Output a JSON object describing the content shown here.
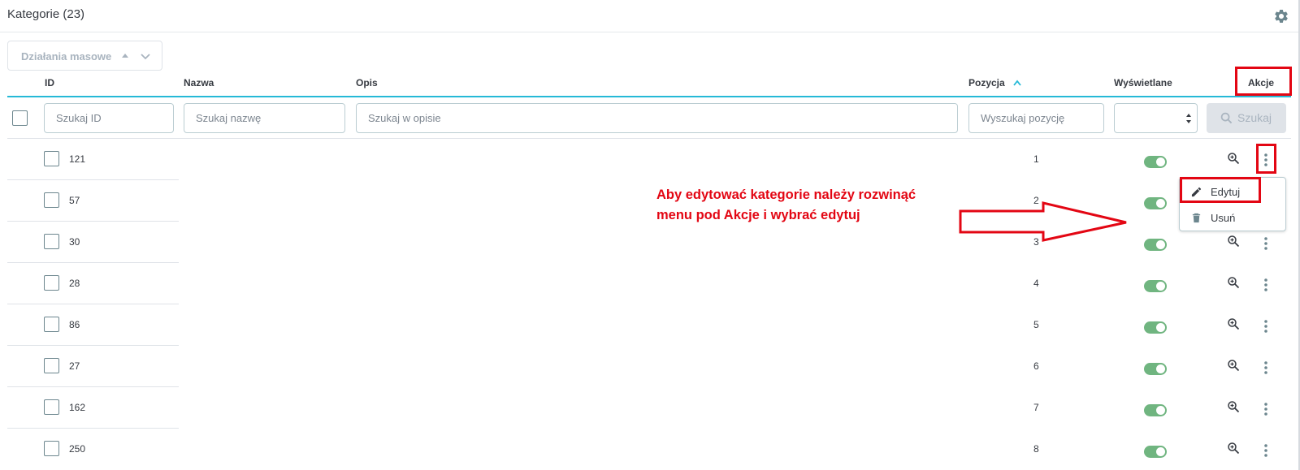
{
  "panel": {
    "title": "Kategorie (23)",
    "settings_icon": "gear-icon"
  },
  "bulk_actions": {
    "label": "Działania masowe"
  },
  "columns": {
    "id": "ID",
    "name": "Nazwa",
    "description": "Opis",
    "position": "Pozycja",
    "displayed": "Wyświetlane",
    "actions": "Akcje"
  },
  "filters": {
    "id_placeholder": "Szukaj ID",
    "name_placeholder": "Szukaj nazwę",
    "description_placeholder": "Szukaj w opisie",
    "position_placeholder": "Wyszukaj pozycję",
    "displayed_value": "",
    "search_label": "Szukaj"
  },
  "rows": [
    {
      "id": "121",
      "position": "1",
      "displayed": true
    },
    {
      "id": "57",
      "position": "2",
      "displayed": true
    },
    {
      "id": "30",
      "position": "3",
      "displayed": true
    },
    {
      "id": "28",
      "position": "4",
      "displayed": true
    },
    {
      "id": "86",
      "position": "5",
      "displayed": true
    },
    {
      "id": "27",
      "position": "6",
      "displayed": true
    },
    {
      "id": "162",
      "position": "7",
      "displayed": true
    },
    {
      "id": "250",
      "position": "8",
      "displayed": true
    }
  ],
  "row_menu": {
    "edit": "Edytuj",
    "delete": "Usuń"
  },
  "annotation": {
    "line1": "Aby edytować kategorie należy rozwinąć",
    "line2": "menu pod Akcje i wybrać edytuj"
  },
  "colors": {
    "accent": "#25b9d7",
    "toggle_on": "#70b580",
    "highlight": "#e30613"
  }
}
